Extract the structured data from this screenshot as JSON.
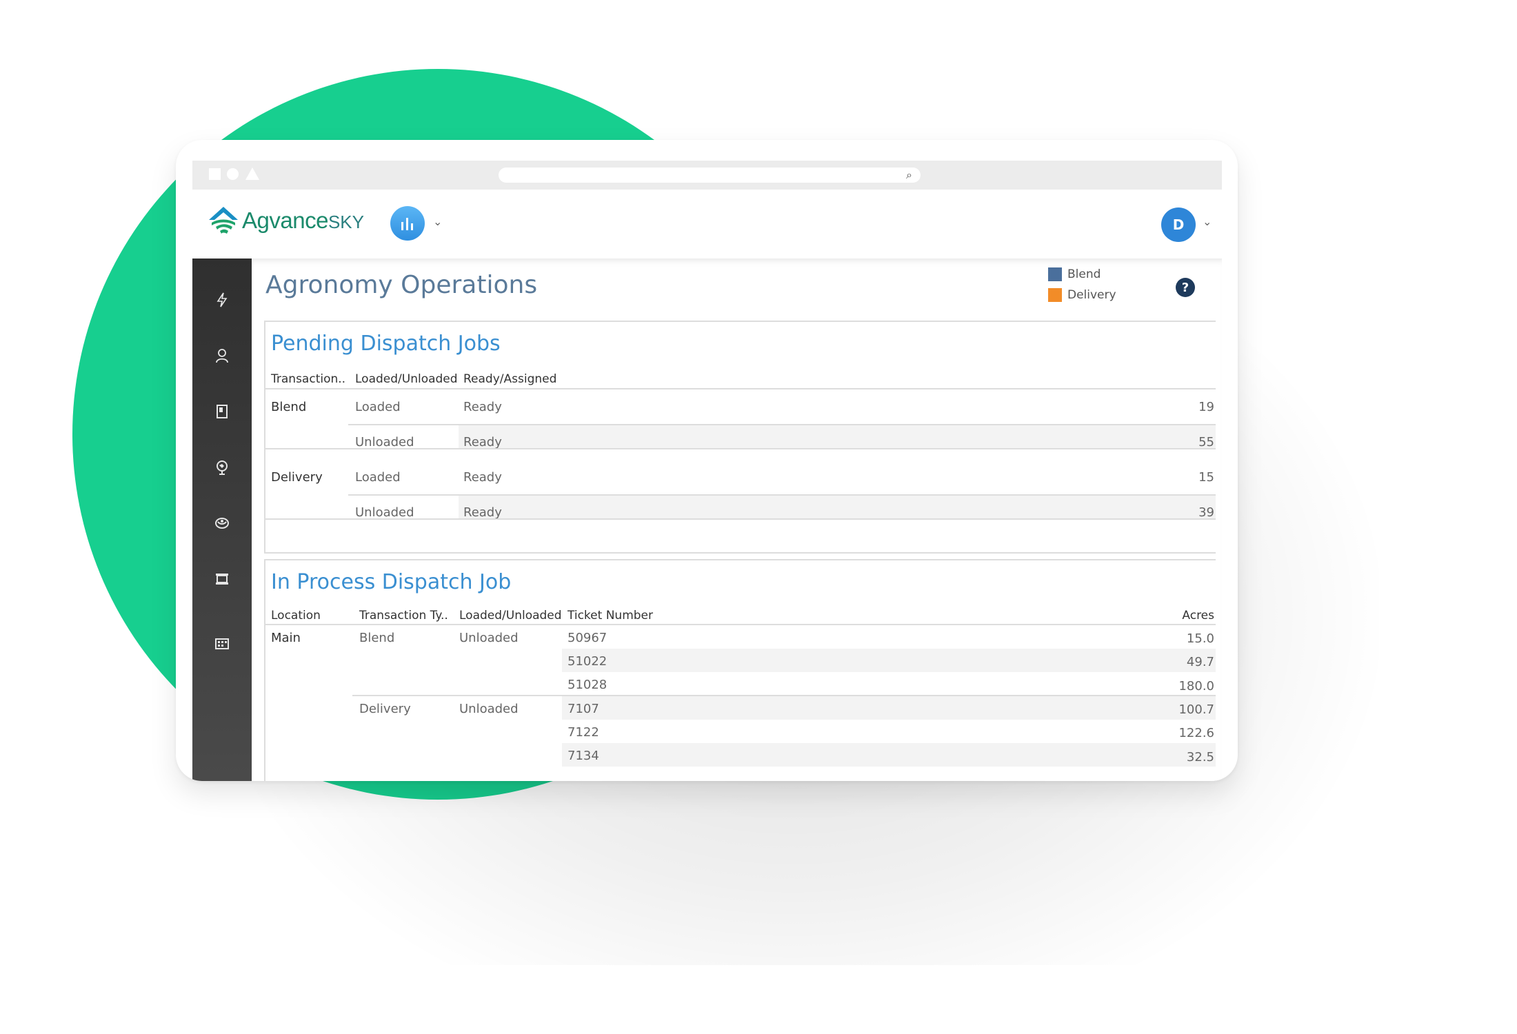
{
  "header": {
    "logo_text": "Agvance",
    "logo_suffix": "SKY",
    "avatar_initial": "D"
  },
  "page": {
    "title": "Agronomy Operations",
    "legend": [
      {
        "label": "Blend",
        "color": "#4a6f9c"
      },
      {
        "label": "Delivery",
        "color": "#f28c28"
      }
    ],
    "help_symbol": "?"
  },
  "pending": {
    "title": "Pending Dispatch Jobs",
    "headers": [
      "Transaction..",
      "Loaded/Unloaded",
      "Ready/Assigned"
    ],
    "groups": [
      {
        "type": "Blend",
        "rows": [
          {
            "loaded": "Loaded",
            "ready": "Ready",
            "count": "19"
          },
          {
            "loaded": "Unloaded",
            "ready": "Ready",
            "count": "55"
          }
        ]
      },
      {
        "type": "Delivery",
        "rows": [
          {
            "loaded": "Loaded",
            "ready": "Ready",
            "count": "15"
          },
          {
            "loaded": "Unloaded",
            "ready": "Ready",
            "count": "39"
          }
        ]
      }
    ]
  },
  "inprocess": {
    "title": "In Process Dispatch Job",
    "headers": [
      "Location",
      "Transaction Ty..",
      "Loaded/Unloaded",
      "Ticket Number",
      "Acres"
    ],
    "location": "Main",
    "groups": [
      {
        "type": "Blend",
        "loaded": "Unloaded",
        "rows": [
          {
            "ticket": "50967",
            "acres": "15.0"
          },
          {
            "ticket": "51022",
            "acres": "49.7"
          },
          {
            "ticket": "51028",
            "acres": "180.0"
          }
        ]
      },
      {
        "type": "Delivery",
        "loaded": "Unloaded",
        "rows": [
          {
            "ticket": "7107",
            "acres": "100.7"
          },
          {
            "ticket": "7122",
            "acres": "122.6"
          },
          {
            "ticket": "7134",
            "acres": "32.5"
          }
        ]
      }
    ]
  },
  "sidebar": {
    "icons": [
      "lightning-icon",
      "user-icon",
      "book-icon",
      "globe-icon",
      "seed-icon",
      "tray-icon",
      "building-icon"
    ]
  }
}
